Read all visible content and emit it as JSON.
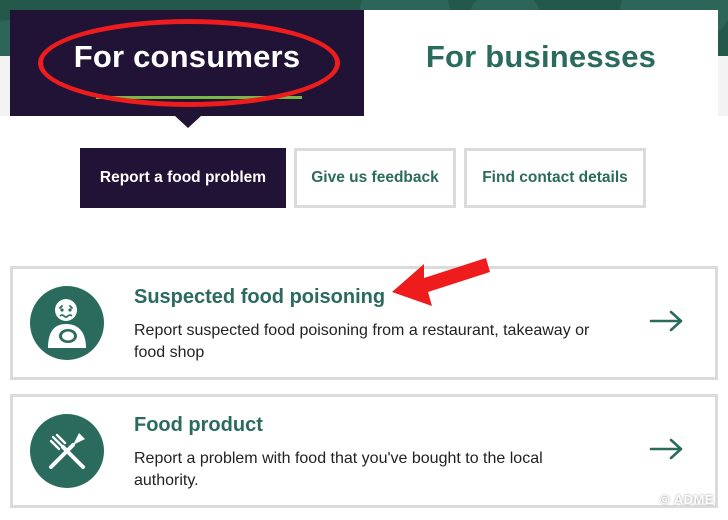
{
  "audience_tabs": [
    {
      "label": "For consumers",
      "active": true
    },
    {
      "label": "For businesses",
      "active": false
    }
  ],
  "sub_nav": [
    {
      "label": "Report a food problem",
      "active": true
    },
    {
      "label": "Give us feedback",
      "active": false
    },
    {
      "label": "Find contact details",
      "active": false
    }
  ],
  "cards": [
    {
      "title": "Suspected food poisoning",
      "description": "Report suspected food poisoning from a restaurant, takeaway or food shop",
      "icon": "sick-person-icon"
    },
    {
      "title": "Food product",
      "description": "Report a problem with food that you've bought to the local authority.",
      "icon": "fork-knife-icon"
    }
  ],
  "watermark": "© ADME",
  "colors": {
    "brand_dark": "#201336",
    "brand_green": "#2a6b5e",
    "accent_lime": "#7ab648",
    "annotation_red": "#ee1c1c",
    "border_gray": "#d9dcdb"
  }
}
